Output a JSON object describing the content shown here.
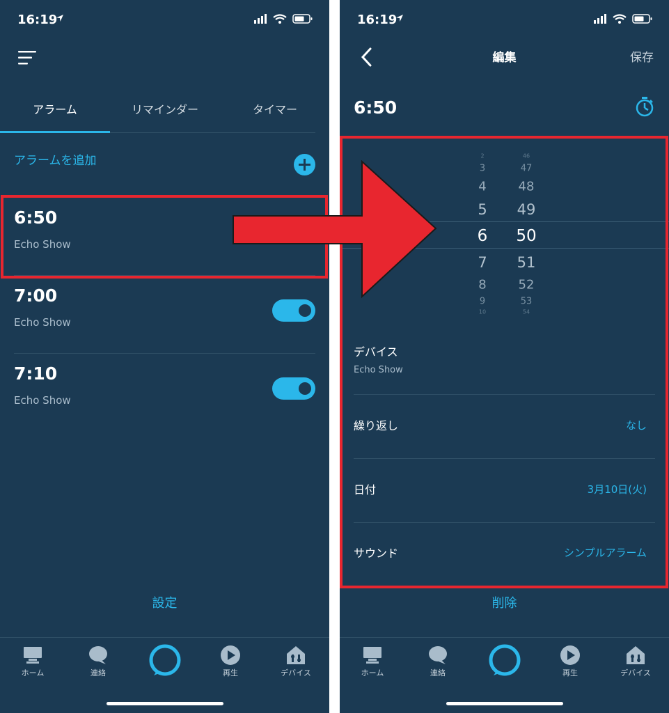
{
  "status_bar": {
    "time": "16:19"
  },
  "left_screen": {
    "tabs": [
      {
        "label": "アラーム"
      },
      {
        "label": "リマインダー"
      },
      {
        "label": "タイマー"
      }
    ],
    "add_alarm_label": "アラームを追加",
    "alarms": [
      {
        "time": "6:50",
        "device": "Echo Show"
      },
      {
        "time": "7:00",
        "device": "Echo Show"
      },
      {
        "time": "7:10",
        "device": "Echo Show"
      }
    ],
    "settings_label": "設定"
  },
  "right_screen": {
    "title": "編集",
    "save_label": "保存",
    "time": "6:50",
    "picker": {
      "hours": [
        "2",
        "3",
        "4",
        "5",
        "6",
        "7",
        "8",
        "9",
        "10"
      ],
      "minutes": [
        "46",
        "47",
        "48",
        "49",
        "50",
        "51",
        "52",
        "53",
        "54"
      ],
      "selected_hour": "6",
      "selected_minute": "50"
    },
    "settings": {
      "device_label": "デバイス",
      "device_value": "Echo Show",
      "repeat_label": "繰り返し",
      "repeat_value": "なし",
      "date_label": "日付",
      "date_value": "3月10日(火)",
      "sound_label": "サウンド",
      "sound_value": "シンプルアラーム"
    },
    "delete_label": "削除"
  },
  "bottom_nav": {
    "items": [
      {
        "label": "ホーム",
        "icon": "home-icon"
      },
      {
        "label": "連絡",
        "icon": "chat-bubble-icon"
      },
      {
        "label": "",
        "icon": "alexa-ring-icon"
      },
      {
        "label": "再生",
        "icon": "play-circle-icon"
      },
      {
        "label": "デバイス",
        "icon": "devices-house-icon"
      }
    ]
  },
  "colors": {
    "background": "#1b3a53",
    "accent": "#2bb7ea",
    "annotation_red": "#e8262f"
  }
}
